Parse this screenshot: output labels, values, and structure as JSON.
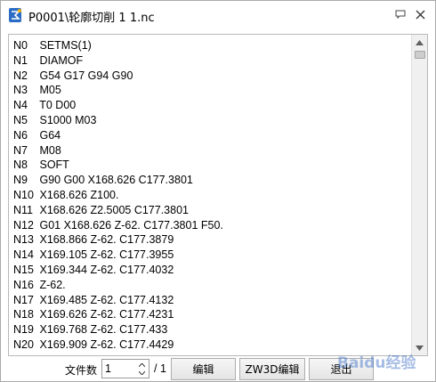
{
  "window": {
    "title": "P0001\\轮廓切削 1 1.nc",
    "icons": {
      "app": "app-logo-icon",
      "comment": "comment-icon",
      "close": "close-icon"
    }
  },
  "editor": {
    "lines": [
      {
        "n": "N0",
        "code": "SETMS(1)"
      },
      {
        "n": "N1",
        "code": "DIAMOF"
      },
      {
        "n": "N2",
        "code": "G54 G17 G94 G90"
      },
      {
        "n": "N3",
        "code": "M05"
      },
      {
        "n": "N4",
        "code": "T0 D00"
      },
      {
        "n": "N5",
        "code": "S1000 M03"
      },
      {
        "n": "N6",
        "code": "G64"
      },
      {
        "n": "N7",
        "code": "M08"
      },
      {
        "n": "N8",
        "code": "SOFT"
      },
      {
        "n": "N9",
        "code": "G90 G00 X168.626 C177.3801"
      },
      {
        "n": "N10",
        "code": "X168.626 Z100."
      },
      {
        "n": "N11",
        "code": "X168.626 Z2.5005 C177.3801"
      },
      {
        "n": "N12",
        "code": "G01 X168.626 Z-62. C177.3801 F50."
      },
      {
        "n": "N13",
        "code": "X168.866 Z-62. C177.3879"
      },
      {
        "n": "N14",
        "code": "X169.105 Z-62. C177.3955"
      },
      {
        "n": "N15",
        "code": "X169.344 Z-62. C177.4032"
      },
      {
        "n": "N16",
        "code": "Z-62."
      },
      {
        "n": "N17",
        "code": "X169.485 Z-62. C177.4132"
      },
      {
        "n": "N18",
        "code": "X169.626 Z-62. C177.4231"
      },
      {
        "n": "N19",
        "code": "X169.768 Z-62. C177.433"
      },
      {
        "n": "N20",
        "code": "X169.909 Z-62. C177.4429"
      }
    ]
  },
  "bottom": {
    "files_label": "文件数",
    "file_value": "1",
    "total": "/ 1",
    "edit_button": "编辑",
    "zw3d_button": "ZW3D编辑",
    "exit_button": "退出"
  },
  "watermark": {
    "text": "Baidu经验"
  }
}
